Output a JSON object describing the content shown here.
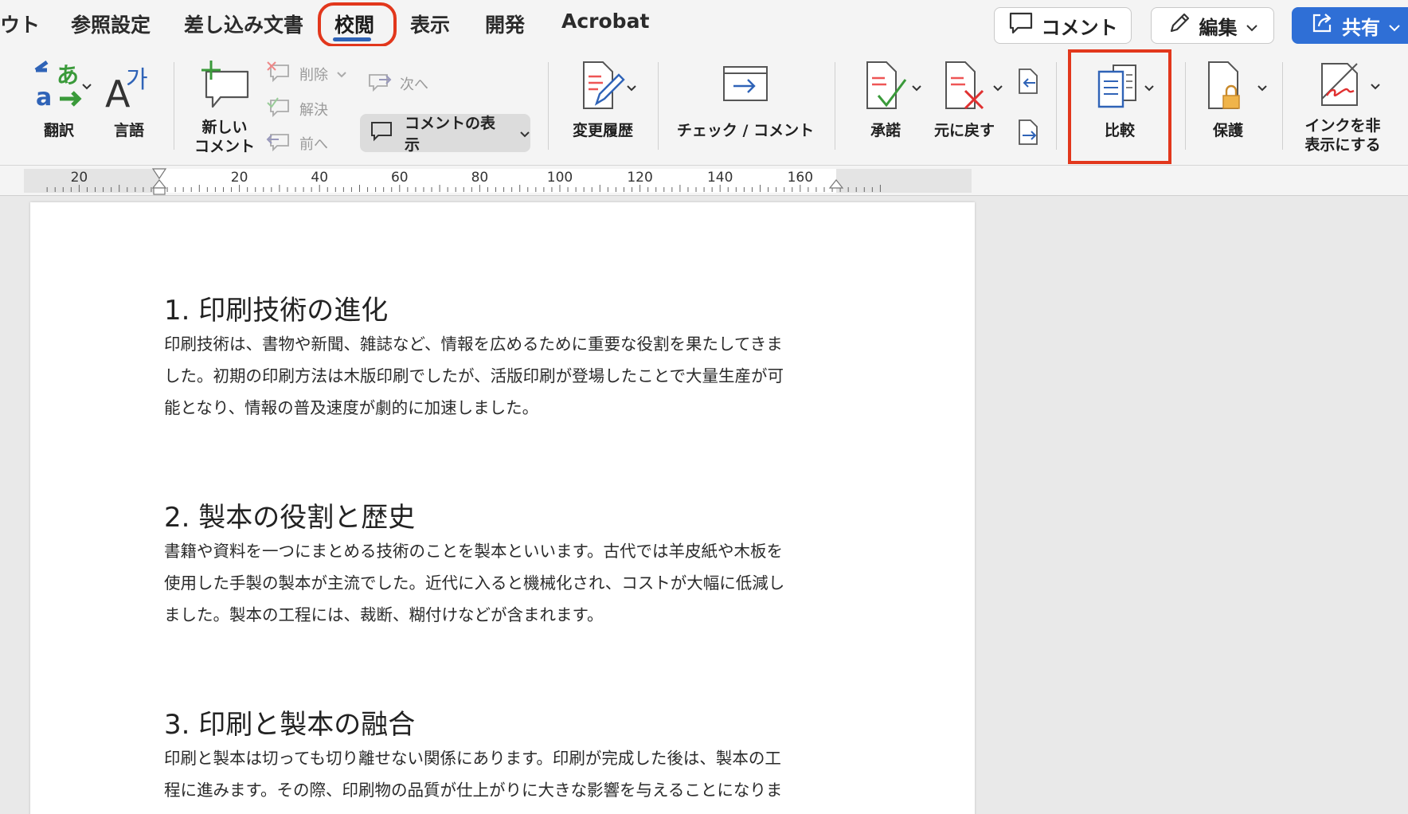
{
  "tabs": [
    "ウト",
    "参照設定",
    "差し込み文書",
    "校閲",
    "表示",
    "開発",
    "Acrobat"
  ],
  "active_tab": "校閲",
  "top_buttons": {
    "comment": "コメント",
    "edit": "編集",
    "share": "共有"
  },
  "ribbon": {
    "translate": "翻訳",
    "language": "言語",
    "new_comment": [
      "新しい",
      "コメント"
    ],
    "delete": "削除",
    "resolve": "解決",
    "previous": "前へ",
    "next": "次へ",
    "show_comments": "コメントの表示",
    "track_changes": "変更履歴",
    "check_comment": "チェック / コメント",
    "accept": "承諾",
    "reject": "元に戻す",
    "compare": "比較",
    "protect": "保護",
    "hide_ink": [
      "インクを非",
      "表示にする"
    ]
  },
  "ruler": {
    "labels": [
      "20",
      "20",
      "40",
      "60",
      "80",
      "100",
      "120",
      "140",
      "160"
    ]
  },
  "document": {
    "sections": [
      {
        "heading": "1. 印刷技術の進化",
        "lines": [
          "印刷技術は、書物や新聞、雑誌など、情報を広めるために重要な役割を果たしてきま",
          "した。初期の印刷方法は木版印刷でしたが、活版印刷が登場したことで大量生産が可",
          "能となり、情報の普及速度が劇的に加速しました。"
        ]
      },
      {
        "heading": "2. 製本の役割と歴史",
        "lines": [
          "書籍や資料を一つにまとめる技術のことを製本といいます。古代では羊皮紙や木板を",
          "使用した手製の製本が主流でした。近代に入ると機械化され、コストが大幅に低減し",
          "ました。製本の工程には、裁断、糊付けなどが含まれます。"
        ]
      },
      {
        "heading": "3. 印刷と製本の融合",
        "lines": [
          "印刷と製本は切っても切り離せない関係にあります。印刷が完成した後は、製本の工",
          "程に進みます。その際、印刷物の品質が仕上がりに大きな影響を与えることになりま"
        ]
      }
    ]
  },
  "colors": {
    "accent": "#2f6fd6",
    "annotation": "#e2371c",
    "tab_underline": "#2f63b7"
  }
}
